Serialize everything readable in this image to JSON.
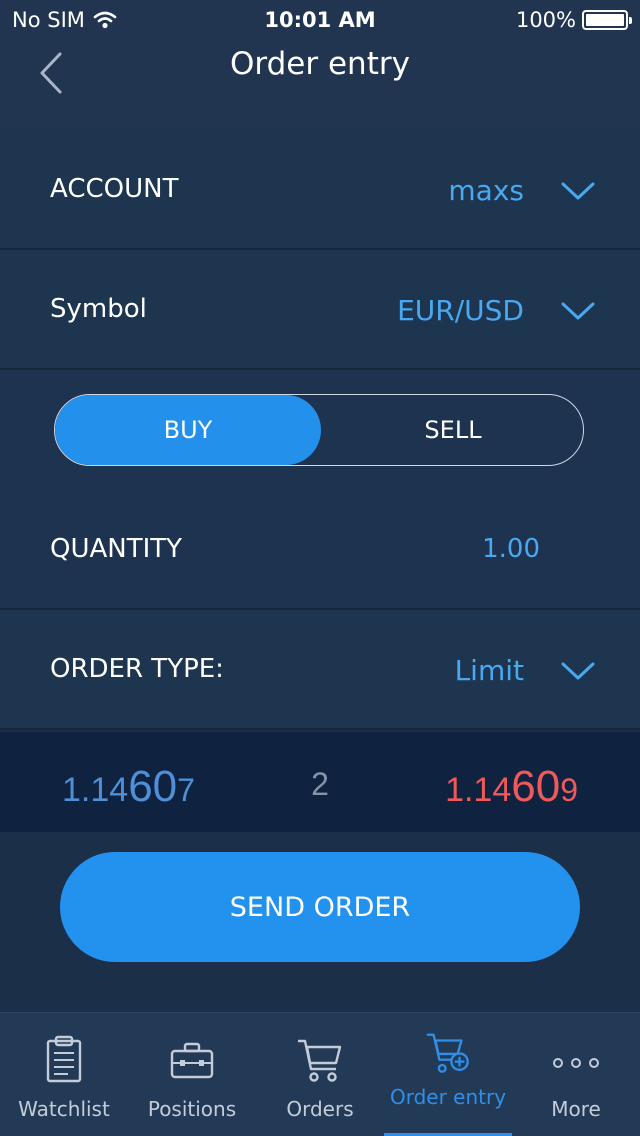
{
  "status_bar": {
    "carrier": "No SIM",
    "time": "10:01 AM",
    "battery": "100%"
  },
  "nav": {
    "title": "Order entry",
    "back_icon": "chevron-left-icon"
  },
  "account": {
    "label": "ACCOUNT",
    "value": "maxs"
  },
  "symbol": {
    "label": "Symbol",
    "value": "EUR/USD"
  },
  "side": {
    "buy_label": "BUY",
    "sell_label": "SELL",
    "selected": "BUY"
  },
  "quantity": {
    "label": "QUANTITY",
    "value": "1.00"
  },
  "order_type": {
    "label": "ORDER TYPE:",
    "value": "Limit"
  },
  "quotes": {
    "bid": {
      "prefix": "1.14",
      "big": "60",
      "suffix": "7"
    },
    "spread": "2",
    "ask": {
      "prefix": "1.14",
      "big": "60",
      "suffix": "9"
    }
  },
  "send_label": "SEND ORDER",
  "tabs": [
    {
      "label": "Watchlist",
      "icon": "clipboard-icon"
    },
    {
      "label": "Positions",
      "icon": "briefcase-icon"
    },
    {
      "label": "Orders",
      "icon": "cart-icon"
    },
    {
      "label": "Order entry",
      "icon": "cart-plus-icon",
      "active": true
    },
    {
      "label": "More",
      "icon": "more-dots-icon"
    }
  ],
  "colors": {
    "accent": "#2390ec",
    "bid": "#4f8fd8",
    "ask": "#ee5a59",
    "background": "#1d3049"
  }
}
